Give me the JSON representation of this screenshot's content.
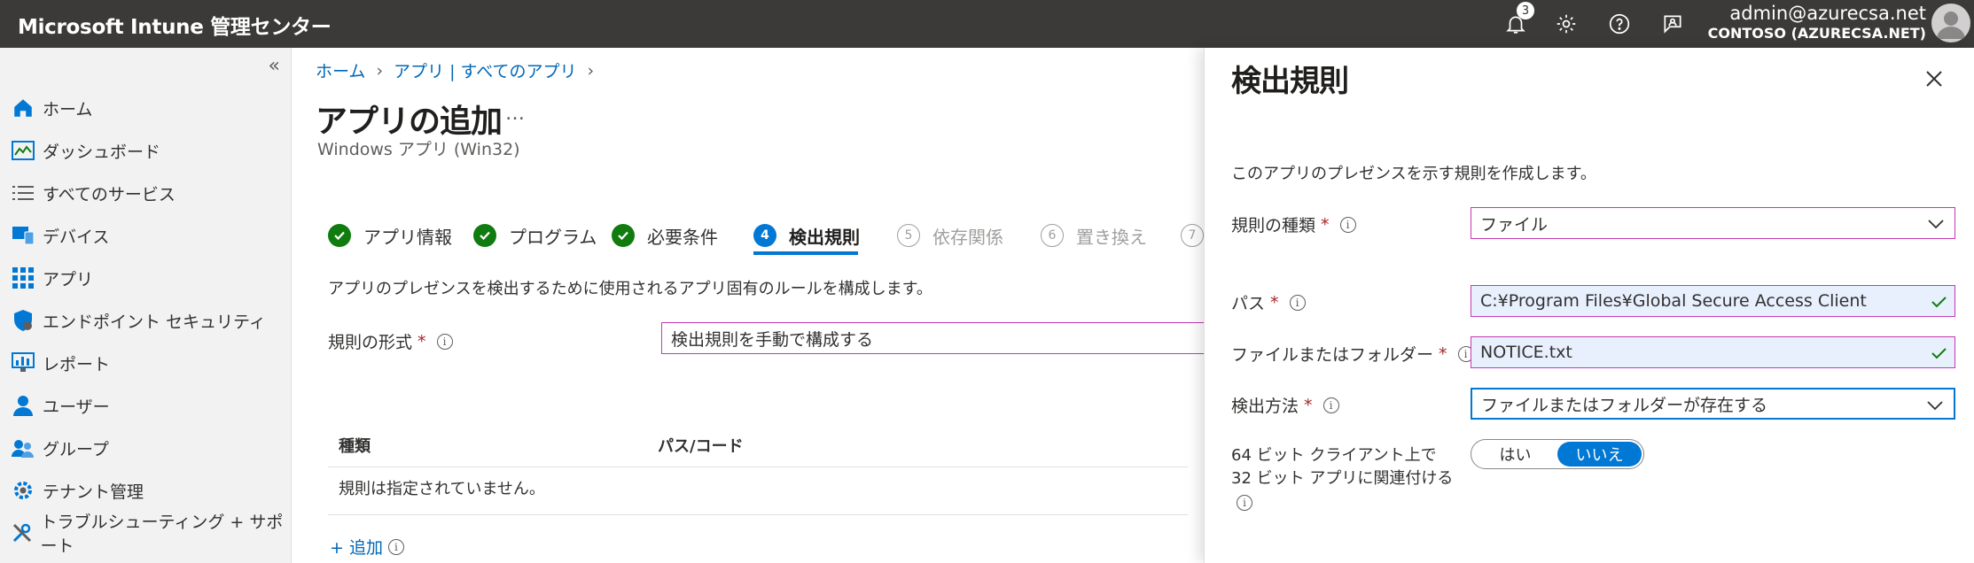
{
  "topbar": {
    "app_title": "Microsoft Intune 管理センター",
    "notification_count": "3",
    "user_email": "admin@azurecsa.net",
    "tenant": "CONTOSO (AZURECSA.NET)"
  },
  "sidebar": {
    "collapse_glyph": "«",
    "items": [
      {
        "label": "ホーム",
        "icon": "home-icon"
      },
      {
        "label": "ダッシュボード",
        "icon": "dashboard-icon"
      },
      {
        "label": "すべてのサービス",
        "icon": "list-icon"
      },
      {
        "label": "デバイス",
        "icon": "devices-icon"
      },
      {
        "label": "アプリ",
        "icon": "apps-icon"
      },
      {
        "label": "エンドポイント セキュリティ",
        "icon": "shield-icon"
      },
      {
        "label": "レポート",
        "icon": "reports-icon"
      },
      {
        "label": "ユーザー",
        "icon": "user-icon"
      },
      {
        "label": "グループ",
        "icon": "group-icon"
      },
      {
        "label": "テナント管理",
        "icon": "tenant-icon"
      },
      {
        "label": "トラブルシューティング + サポート",
        "icon": "troubleshoot-icon"
      }
    ]
  },
  "main": {
    "breadcrumb": [
      "ホーム",
      "アプリ | すべてのアプリ"
    ],
    "title": "アプリの追加",
    "more": "…",
    "subtitle": "Windows アプリ (Win32)",
    "steps": [
      {
        "num": "",
        "label": "アプリ情報",
        "state": "done"
      },
      {
        "num": "",
        "label": "プログラム",
        "state": "done"
      },
      {
        "num": "",
        "label": "必要条件",
        "state": "done"
      },
      {
        "num": "4",
        "label": "検出規則",
        "state": "active"
      },
      {
        "num": "5",
        "label": "依存関係",
        "state": "todo"
      },
      {
        "num": "6",
        "label": "置き換え",
        "state": "todo"
      },
      {
        "num": "7",
        "label": "",
        "state": "todo"
      }
    ],
    "description": "アプリのプレゼンスを検出するために使用されるアプリ固有のルールを構成します。",
    "format_label": "規則の形式",
    "required_mark": "*",
    "format_value": "検出規則を手動で構成する",
    "table": {
      "headers": [
        "種類",
        "パス/コード"
      ],
      "empty_text": "規則は指定されていません。"
    },
    "add_label": "+ 追加"
  },
  "panel": {
    "title": "検出規則",
    "description": "このアプリのプレゼンスを示す規則を作成します。",
    "rule_type_label": "規則の種類",
    "rule_type_value": "ファイル",
    "path_label": "パス",
    "path_value": "C:¥Program Files¥Global Secure Access Client",
    "file_label": "ファイルまたはフォルダー",
    "file_value": "NOTICE.txt",
    "method_label": "検出方法",
    "method_value": "ファイルまたはフォルダーが存在する",
    "assoc_label": "64 ビット クライアント上で 32 ビット アプリに関連付ける",
    "toggle_yes": "はい",
    "toggle_no": "いいえ",
    "toggle_selected": "いいえ"
  },
  "colors": {
    "topbar": "#3b3a39",
    "accent": "#0078d4",
    "success": "#107c10",
    "required": "#a4262c",
    "field_border_pink": "#c239b3"
  }
}
